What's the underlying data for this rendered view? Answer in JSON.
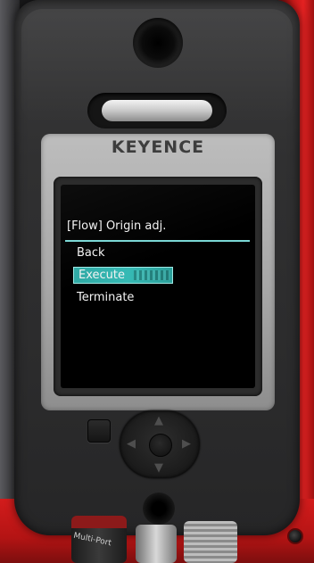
{
  "device": {
    "brand": "KEYENCE",
    "port_label": "Multi-Port"
  },
  "screen": {
    "title": "[Flow] Origin adj.",
    "menu": [
      {
        "label": "Back",
        "selected": false
      },
      {
        "label": "Execute",
        "selected": true
      },
      {
        "label": "Terminate",
        "selected": false
      }
    ]
  },
  "controls": {
    "dpad_icons": {
      "up": "▲",
      "down": "▼",
      "left": "◀",
      "right": "▶"
    }
  },
  "colors": {
    "selection_highlight": "#36bab5",
    "divider": "#7ad8d6",
    "frame_red": "#d31c1c"
  }
}
